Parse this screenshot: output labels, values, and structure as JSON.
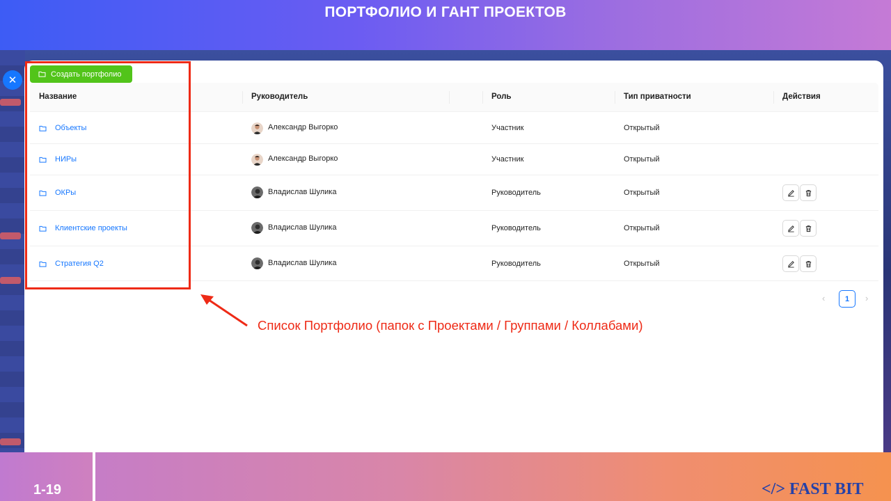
{
  "slide": {
    "title": "ПОРТФОЛИО И ГАНТ ПРОЕКТОВ",
    "page_number": "1-19",
    "brand": "</> FAST BIT"
  },
  "toolbar": {
    "create_label": "Создать портфолио"
  },
  "close_button": {
    "icon": "close-icon"
  },
  "table": {
    "headers": {
      "name": "Название",
      "manager": "Руководитель",
      "role": "Роль",
      "privacy": "Тип приватности",
      "actions": "Действия"
    },
    "rows": [
      {
        "name": "Объекты",
        "manager": "Александр Выгорко",
        "role": "Участник",
        "privacy": "Открытый",
        "actions": false
      },
      {
        "name": "НИРы",
        "manager": "Александр Выгорко",
        "role": "Участник",
        "privacy": "Открытый",
        "actions": false
      },
      {
        "name": "ОКРы",
        "manager": "Владислав Шулика",
        "role": "Руководитель",
        "privacy": "Открытый",
        "actions": true
      },
      {
        "name": "Клиентские проекты",
        "manager": "Владислав Шулика",
        "role": "Руководитель",
        "privacy": "Открытый",
        "actions": true
      },
      {
        "name": "Стратегия Q2",
        "manager": "Владислав Шулика",
        "role": "Руководитель",
        "privacy": "Открытый",
        "actions": true
      }
    ]
  },
  "pagination": {
    "current_page": "1",
    "prev_icon": "chevron-left-icon",
    "next_icon": "chevron-right-icon"
  },
  "annotation": {
    "text": "Список Портфолио (папок с Проектами / Группами / Коллабами)",
    "color": "#ee2a16"
  },
  "colors": {
    "primary": "#1677ff",
    "create_button": "#52c41a",
    "annotation": "#ee2a16",
    "brand": "#2541a8"
  }
}
